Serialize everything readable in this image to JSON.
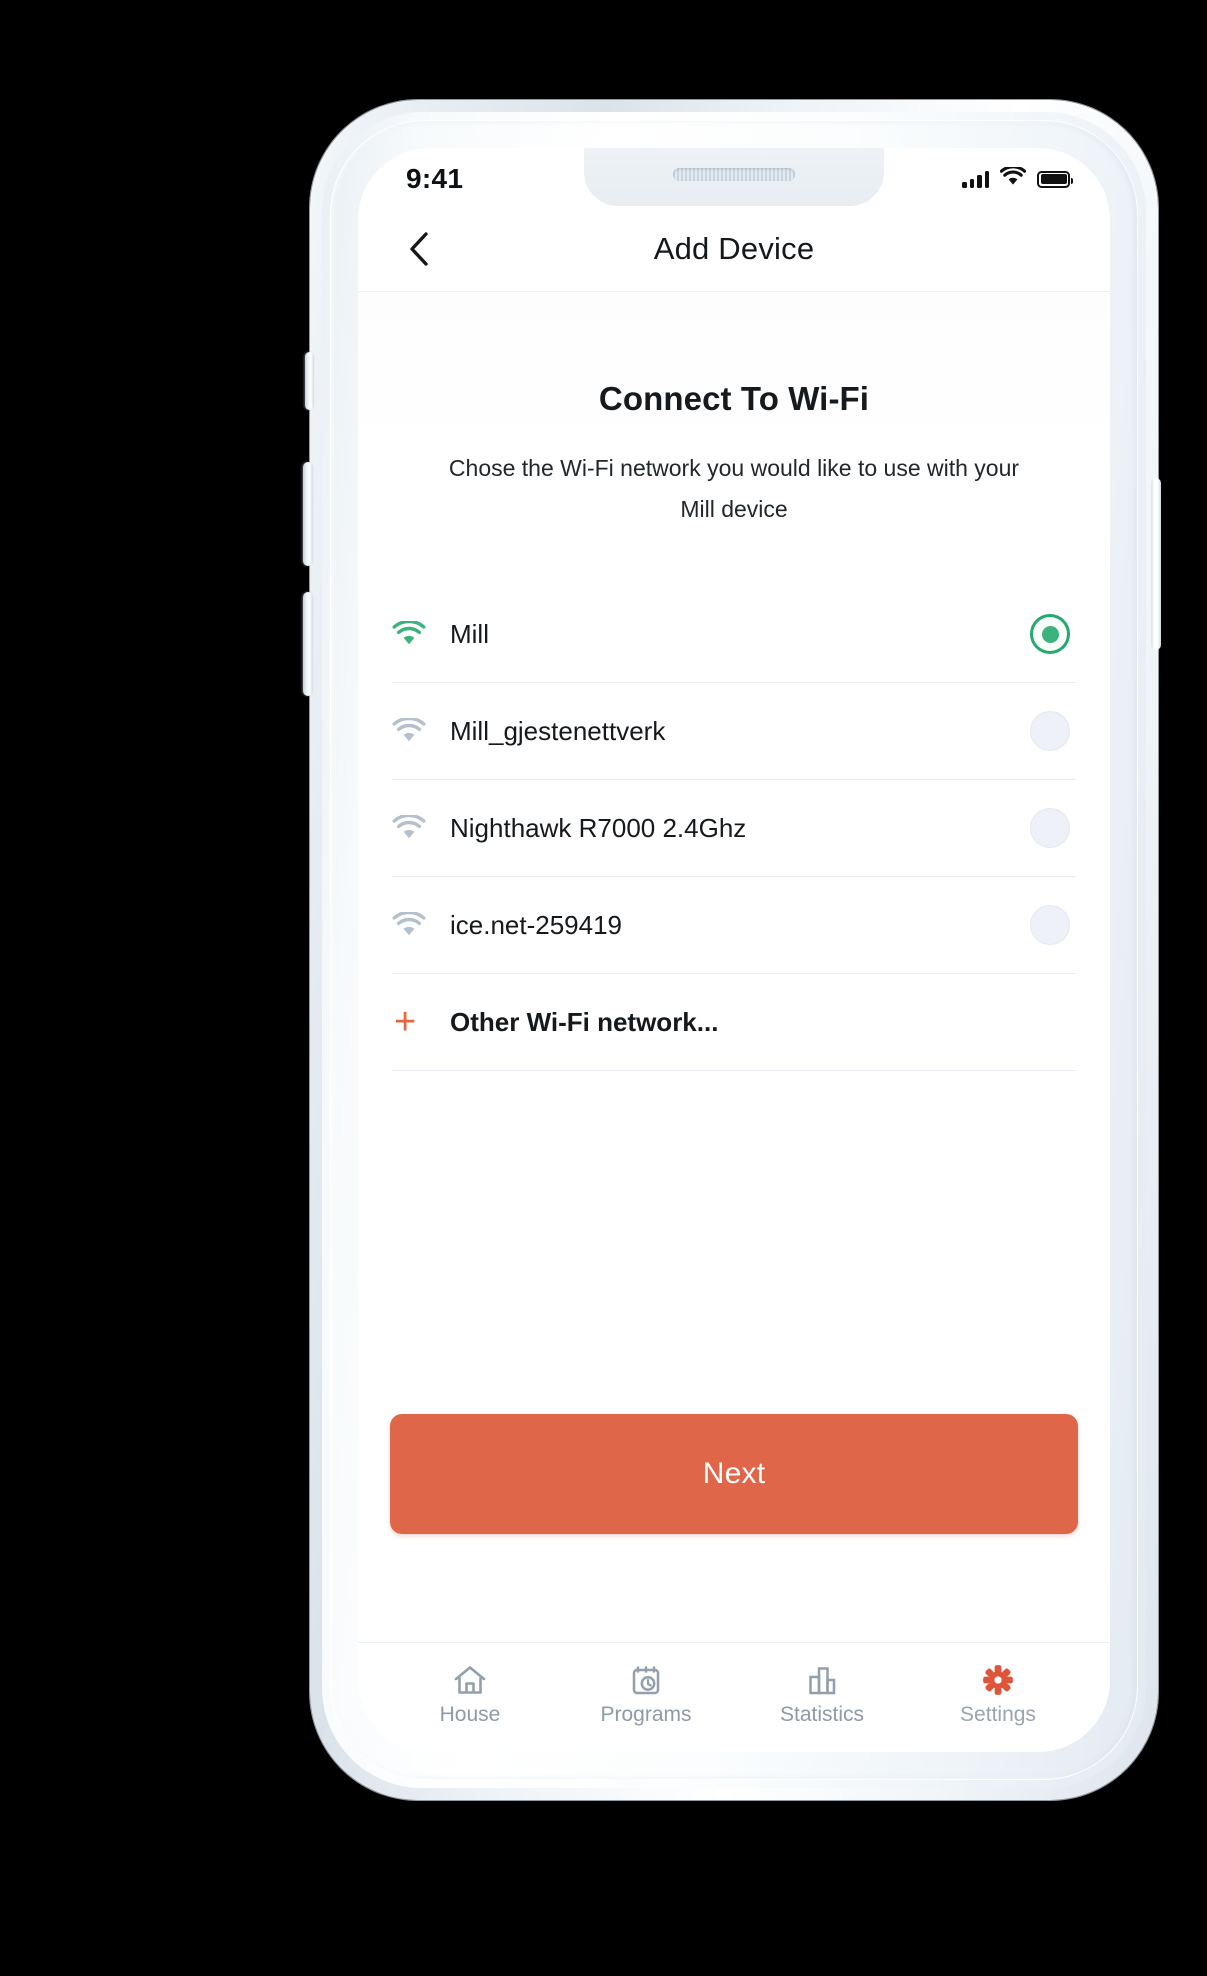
{
  "colors": {
    "accent_orange": "#e0664a",
    "accent_green": "#3cb27e",
    "radio_off": "#eef1f8",
    "text_dark": "#15191c",
    "text_muted": "#8e9aa6"
  },
  "status_bar": {
    "time": "9:41",
    "signal_icon": "cellular-signal-icon",
    "wifi_icon": "wifi-icon",
    "battery_icon": "battery-full-icon"
  },
  "navbar": {
    "back_icon": "chevron-left-icon",
    "title": "Add Device"
  },
  "main": {
    "heading": "Connect To Wi-Fi",
    "subtitle": "Chose the Wi-Fi network you would like  to use with your Mill device",
    "networks": [
      {
        "name": "Mill",
        "selected": true,
        "icon": "wifi-icon"
      },
      {
        "name": "Mill_gjestenettverk",
        "selected": false,
        "icon": "wifi-icon"
      },
      {
        "name": "Nighthawk R7000 2.4Ghz",
        "selected": false,
        "icon": "wifi-icon"
      },
      {
        "name": "ice.net-259419",
        "selected": false,
        "icon": "wifi-icon"
      }
    ],
    "other_network": {
      "label": "Other Wi-Fi network...",
      "icon": "plus-icon"
    },
    "primary_button": "Next"
  },
  "tabbar": {
    "items": [
      {
        "label": "House",
        "icon": "home-icon",
        "active": false
      },
      {
        "label": "Programs",
        "icon": "calendar-clock-icon",
        "active": false
      },
      {
        "label": "Statistics",
        "icon": "bar-chart-icon",
        "active": false
      },
      {
        "label": "Settings",
        "icon": "gear-icon",
        "active": true
      }
    ]
  }
}
